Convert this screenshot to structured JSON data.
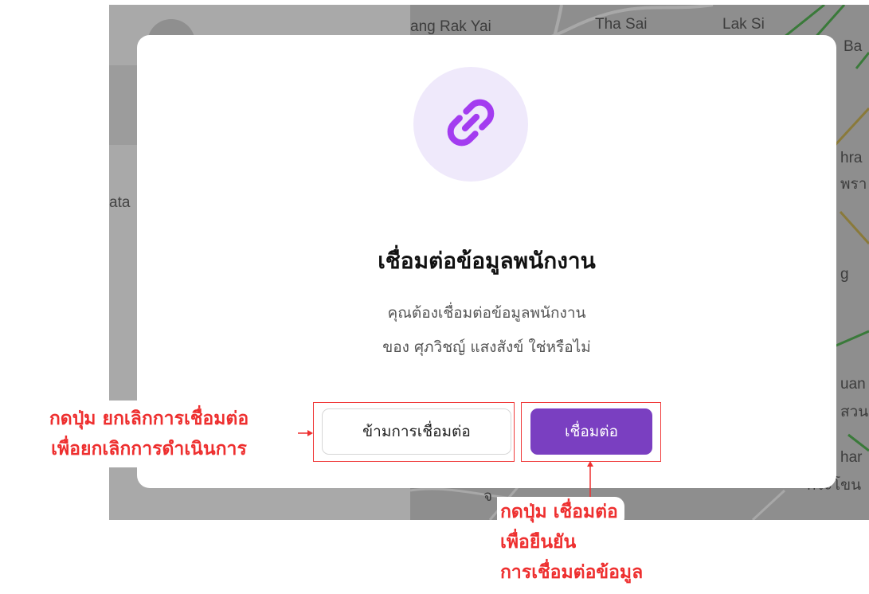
{
  "background": {
    "app_label_partial": "ata",
    "map_labels": [
      "ang Rak Yai",
      "Tha Sai",
      "Lak Si",
      "Ba",
      "hra",
      "พรา",
      "g",
      "uan",
      "สวน",
      "har",
      "กระโขน",
      "จ"
    ]
  },
  "modal": {
    "icon": "link-icon",
    "title": "เชื่อมต่อข้อมูลพนักงาน",
    "description_lines": [
      "คุณต้องเชื่อมต่อข้อมูลพนักงาน",
      "ของ ศุภวิชญ์ แสงสังข์ ใช่หรือไม่"
    ],
    "skip_button": "ข้ามการเชื่อมต่อ",
    "connect_button": "เชื่อมต่อ"
  },
  "annotations": {
    "left_note": [
      "กดปุ่ม ยกเลิกการเชื่อมต่อ",
      "เพื่อยกเลิกการดำเนินการ"
    ],
    "bottom_note": [
      "กดปุ่ม เชื่อมต่อ",
      "เพื่อยืนยัน",
      "การเชื่อมต่อข้อมูล"
    ]
  },
  "colors": {
    "accent_purple": "#7a3fc1",
    "icon_purple": "#a33cf0",
    "icon_circle_bg": "#efe9fb",
    "annotation_red": "#ee2f2f"
  }
}
